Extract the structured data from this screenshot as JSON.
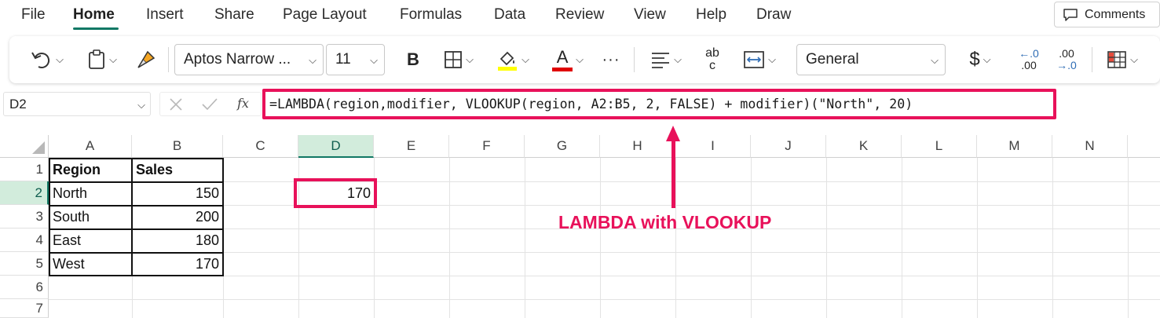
{
  "menu": {
    "tabs": [
      "File",
      "Home",
      "Insert",
      "Share",
      "Page Layout",
      "Formulas",
      "Data",
      "Review",
      "View",
      "Help",
      "Draw"
    ],
    "comments_label": "Comments"
  },
  "ribbon": {
    "font_name": "Aptos Narrow ...",
    "font_size": "11",
    "bold_label": "B",
    "number_format": "General",
    "currency_symbol": "$",
    "more_label": "···",
    "font_color_label": "A",
    "wrap_label_top": "ab",
    "wrap_label_bottom": "c",
    "inc_decimal_top": "←.0",
    "inc_decimal_bottom": ".00",
    "dec_decimal_top": ".00",
    "dec_decimal_bottom": "→.0",
    "fill_color": "#ffff00",
    "font_color": "#e00000"
  },
  "formula_bar": {
    "name_box": "D2",
    "fx_label": "fx",
    "formula": "=LAMBDA(region,modifier, VLOOKUP(region, A2:B5, 2, FALSE) + modifier)(\"North\", 20)"
  },
  "sheet": {
    "columns": [
      "A",
      "B",
      "C",
      "D",
      "E",
      "F",
      "G",
      "H",
      "I",
      "J",
      "K",
      "L",
      "M",
      "N"
    ],
    "rows": [
      "1",
      "2",
      "3",
      "4",
      "5",
      "6",
      "7"
    ],
    "selected_column": "D",
    "selected_row": "2",
    "table": {
      "headers": [
        "Region",
        "Sales"
      ],
      "rows": [
        [
          "North",
          "150"
        ],
        [
          "South",
          "200"
        ],
        [
          "East",
          "180"
        ],
        [
          "West",
          "170"
        ]
      ]
    },
    "d2_value": "170"
  },
  "annotation": {
    "text": "LAMBDA with VLOOKUP",
    "color": "#e8115a"
  }
}
